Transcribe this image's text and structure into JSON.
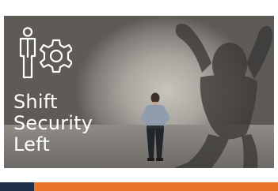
{
  "banner": {
    "headline_line1": "Shift",
    "headline_line2": "Security",
    "headline_line3": "Left",
    "logo_icon": "person-gear-icon"
  },
  "colors": {
    "accent": "#e8752a",
    "bar_dark": "#1f2f4a",
    "text": "#ffffff"
  }
}
